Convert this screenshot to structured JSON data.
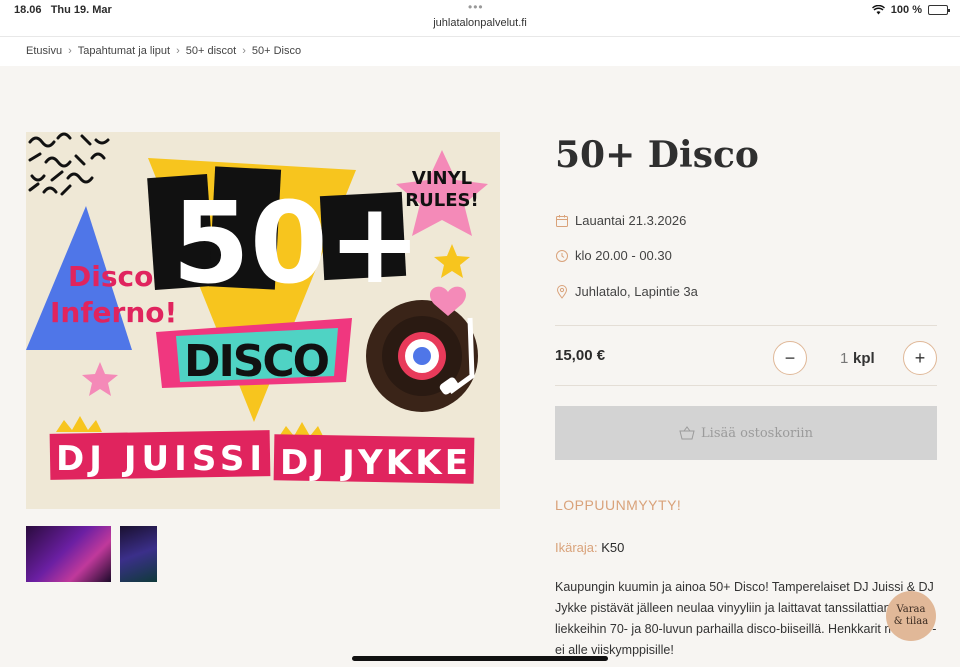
{
  "status": {
    "time": "18.06",
    "date": "Thu 19. Mar",
    "url": "juhlatalonpalvelut.fi",
    "battery": "100 %",
    "battery_level": 1.0
  },
  "breadcrumb": [
    "Etusivu",
    "Tapahtumat ja liput",
    "50+ discot",
    "50+ Disco"
  ],
  "breadcrumb_sep": "›",
  "poster": {
    "big_number": "50+",
    "disco_word": "DISCO",
    "vinyl_star_line1": "VINYL",
    "vinyl_star_line2": "RULES!",
    "inferno_line1": "Disco",
    "inferno_line2": "Inferno!",
    "dj1": "DJ JUISSI",
    "dj2": "DJ JYKKE"
  },
  "product": {
    "title": "50+ Disco",
    "date": "Lauantai 21.3.2026",
    "time": "klo 20.00 - 00.30",
    "location": "Juhlatalo, Lapintie 3a",
    "price": "15,00 €",
    "qty_minus": "−",
    "qty_value": "1",
    "qty_unit": "kpl",
    "qty_plus": "+",
    "cart_label": "Lisää ostoskoriin",
    "soldout": "LOPPUUNMYYTY!",
    "age_label": "Ikäraja:",
    "age_value": "K50",
    "description": "Kaupungin kuumin ja ainoa 50+ Disco! Tamperelaiset DJ Juissi & DJ Jykke pistävät jälleen neulaa vinyyliin ja laittavat tanssilattian liekkeihin 70- ja 80-luvun parhailla disco-biiseillä. Henkkarit mukaan - ei alle viiskymppisille!"
  },
  "fab": {
    "line1": "Varaa",
    "line2": "& tilaa"
  },
  "colors": {
    "accent": "#d9a27a",
    "cart_disabled": "#d3d3d3",
    "fab": "#e1b898"
  },
  "icons": {
    "date": "calendar-icon",
    "time": "clock-icon",
    "location": "pin-icon",
    "cart": "basket-icon"
  }
}
